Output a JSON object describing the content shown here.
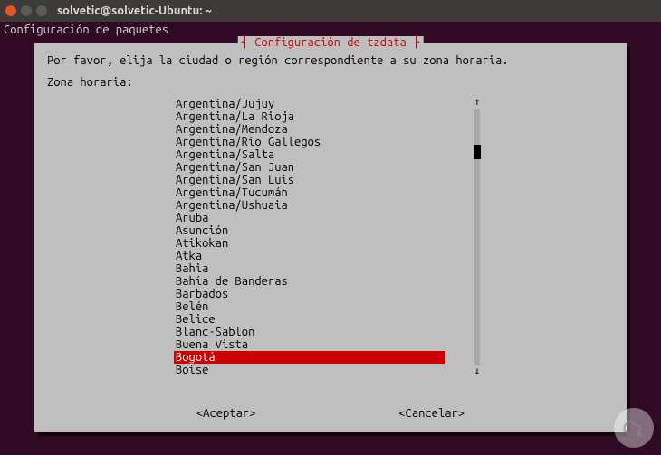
{
  "window": {
    "title": "solvetic@solvetic-Ubuntu: ~"
  },
  "pkg_header": "Configuración de paquetes",
  "dialog": {
    "title": "┤ Configuración de tzdata ├",
    "instruction": "Por favor, elija la ciudad o región correspondiente a su zona horaria.",
    "prompt": "Zona horaria:",
    "items": [
      "Argentina/Jujuy",
      "Argentina/La Rioja",
      "Argentina/Mendoza",
      "Argentina/Rio Gallegos",
      "Argentina/Salta",
      "Argentina/San Juan",
      "Argentina/San Luis",
      "Argentina/Tucumán",
      "Argentina/Ushuaia",
      "Aruba",
      "Asunción",
      "Atikokan",
      "Atka",
      "Bahia",
      "Bahía de Banderas",
      "Barbados",
      "Belén",
      "Belice",
      "Blanc-Sablon",
      "Buena Vista",
      "Bogotá",
      "Boise"
    ],
    "selected_index": 20,
    "accept": "<Aceptar>",
    "cancel": "<Cancelar>"
  }
}
